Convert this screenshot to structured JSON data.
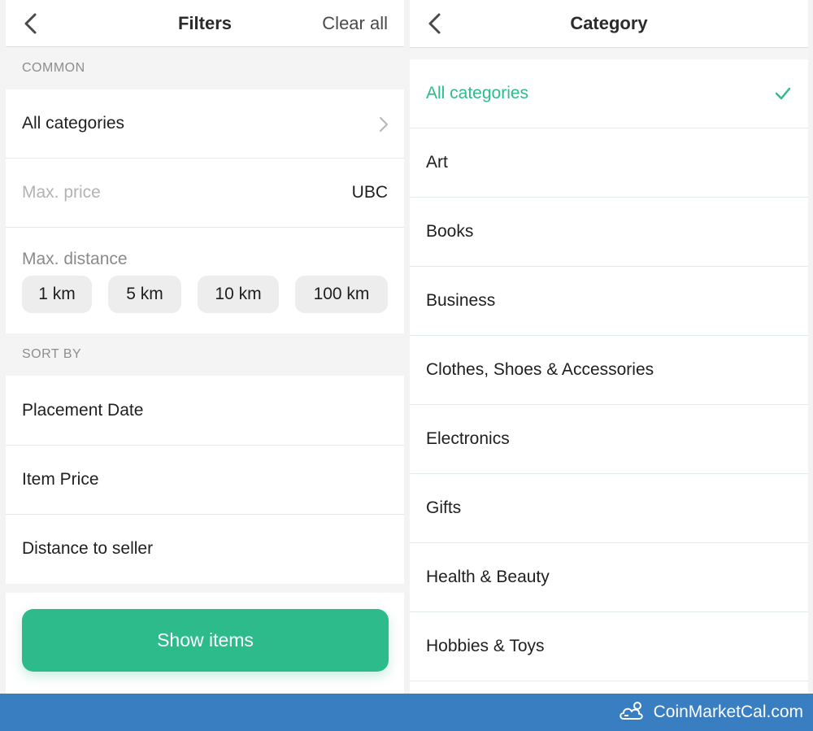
{
  "filters": {
    "title": "Filters",
    "action": "Clear all",
    "common_header": "COMMON",
    "category_label": "All categories",
    "price_placeholder": "Max. price",
    "currency": "UBC",
    "distance_label": "Max. distance",
    "distances": [
      "1 km",
      "5 km",
      "10 km",
      "100 km"
    ],
    "sort_header": "SORT BY",
    "sort_options": [
      "Placement Date",
      "Item Price",
      "Distance to seller"
    ],
    "show_button": "Show items"
  },
  "category": {
    "title": "Category",
    "items": [
      {
        "label": "All categories",
        "selected": true
      },
      {
        "label": "Art"
      },
      {
        "label": "Books"
      },
      {
        "label": "Business"
      },
      {
        "label": "Clothes, Shoes & Accessories"
      },
      {
        "label": "Electronics"
      },
      {
        "label": "Gifts"
      },
      {
        "label": "Health & Beauty"
      },
      {
        "label": "Hobbies & Toys"
      }
    ]
  },
  "footer": {
    "brand": "CoinMarketCal.com"
  },
  "colors": {
    "accent": "#2ebb8c",
    "footer_bg": "#3a7ec2"
  },
  "icons": {
    "back": "chevron-left-icon",
    "disclosure": "chevron-right-icon",
    "selected": "checkmark-icon",
    "logo": "cloud-coin-icon"
  }
}
